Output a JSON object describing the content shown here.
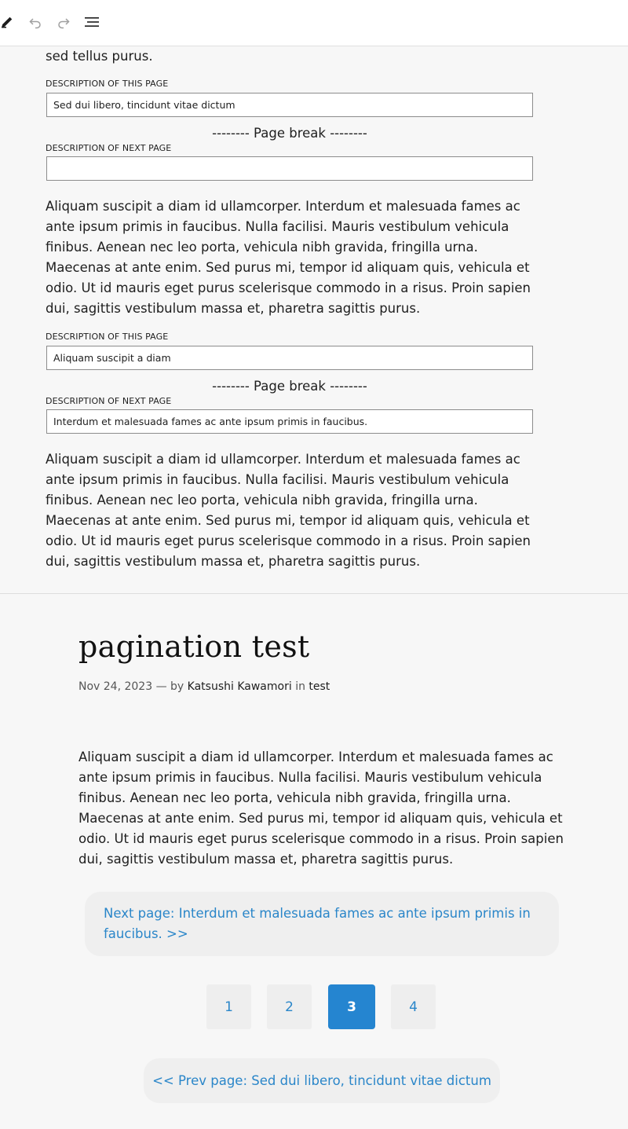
{
  "toolbar": {
    "tools": [
      {
        "name": "pencil-icon",
        "label": "Tools"
      },
      {
        "name": "undo-icon",
        "label": "Undo"
      },
      {
        "name": "redo-icon",
        "label": "Redo"
      },
      {
        "name": "list-view-icon",
        "label": "Document overview"
      }
    ]
  },
  "editor": {
    "blocks": {
      "intro_text": "Pellentesque porta lectus mauris, sed volutpat enim eleifend in. Aliquam sed tellus purus.",
      "break1": {
        "this_label": "DESCRIPTION OF THIS PAGE",
        "this_value": "Sed dui libero, tincidunt vitae dictum",
        "divider": "-------- Page break --------",
        "next_label": "DESCRIPTION OF NEXT PAGE",
        "next_value": ""
      },
      "para2": "Aliquam suscipit a diam id ullamcorper. Interdum et malesuada fames ac ante ipsum primis in faucibus. Nulla facilisi. Mauris vestibulum vehicula finibus. Aenean nec leo porta, vehicula nibh gravida, fringilla urna. Maecenas at ante enim. Sed purus mi, tempor id aliquam quis, vehicula et odio. Ut id mauris eget purus scelerisque commodo in a risus. Proin sapien dui, sagittis vestibulum massa et, pharetra sagittis purus.",
      "break2": {
        "this_label": "DESCRIPTION OF THIS PAGE",
        "this_value": "Aliquam suscipit a diam",
        "divider": "-------- Page break --------",
        "next_label": "DESCRIPTION OF NEXT PAGE",
        "next_value": "Interdum et malesuada fames ac ante ipsum primis in faucibus."
      },
      "para3": "Aliquam suscipit a diam id ullamcorper. Interdum et malesuada fames ac ante ipsum primis in faucibus. Nulla facilisi. Mauris vestibulum vehicula finibus. Aenean nec leo porta, vehicula nibh gravida, fringilla urna. Maecenas at ante enim. Sed purus mi, tempor id aliquam quis, vehicula et odio. Ut id mauris eget purus scelerisque commodo in a risus. Proin sapien dui, sagittis vestibulum massa et, pharetra sagittis purus."
    }
  },
  "preview": {
    "title": "pagination test",
    "meta": {
      "date": "Nov 24, 2023",
      "separator": "— by",
      "author": "Katsushi Kawamori",
      "in_word": "in",
      "category": "test"
    },
    "body": "Aliquam suscipit a diam id ullamcorper. Interdum et malesuada fames ac ante ipsum primis in faucibus. Nulla facilisi. Mauris vestibulum vehicula finibus. Aenean nec leo porta, vehicula nibh gravida, fringilla urna. Maecenas at ante enim. Sed purus mi, tempor id aliquam quis, vehicula et odio. Ut id mauris eget purus scelerisque commodo in a risus. Proin sapien dui, sagittis vestibulum massa et, pharetra sagittis purus.",
    "next_link": "Next page: Interdum et malesuada fames ac ante ipsum primis in faucibus. >>",
    "pages": [
      "1",
      "2",
      "3",
      "4"
    ],
    "current_page": "3",
    "prev_link": "<< Prev page: Sed dui libero, tincidunt vitae dictum"
  },
  "colors": {
    "link": "#2a86c9",
    "current_page_bg": "#2585d0",
    "box_bg": "#efefef",
    "page_bg": "#f7f7f7"
  }
}
